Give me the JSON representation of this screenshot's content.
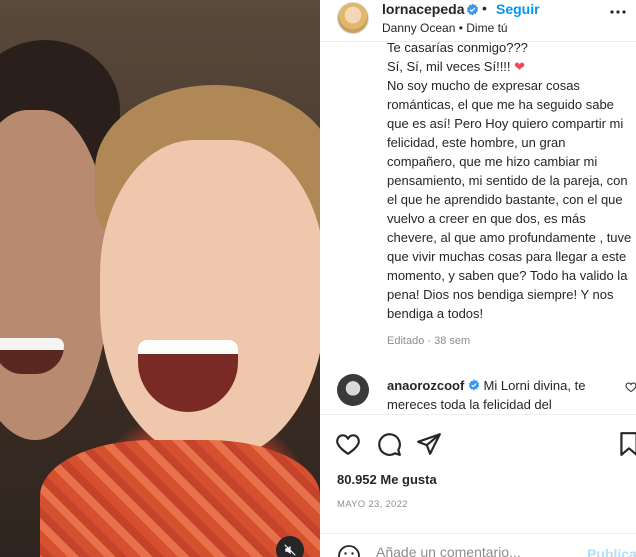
{
  "post": {
    "username": "lornacepeda",
    "follow_label": "Seguir",
    "audio": "Danny Ocean • Dime tú",
    "caption_cut_line": "Te casarías conmigo???",
    "caption_line2": "Sí, Sí, mil veces Sí!!!! ",
    "caption_heart": "❤",
    "caption_body": "No soy mucho de expresar cosas románticas, el que me ha seguido sabe que es así! Pero Hoy quiero compartir mi felicidad, este hombre, un gran compañero, que me hizo cambiar mi pensamiento, mi sentido de la pareja, con el que he aprendido bastante, con el que vuelvo a creer en que dos, es más chevere, al que amo profundamente , tuve que vivir muchas cosas para llegar a este momento, y saben que? Todo ha valido la pena! Dios nos bendiga siempre! Y nos bendiga a todos!",
    "edited": "Editado · 38 sem",
    "likes": "80.952 Me gusta",
    "date": "MAYO 23, 2022"
  },
  "comment": {
    "username": "anaorozcoof",
    "text": "Mi Lorni divina, te mereces toda la felicidad del"
  },
  "add_comment": {
    "placeholder": "Añade un comentario...",
    "publish_label": "Publicar"
  },
  "colors": {
    "accent": "#0095f6",
    "verified": "#3897f0",
    "heart": "#ed4956",
    "muted_text": "#8e8e8e"
  },
  "icons": [
    "verified-badge-icon",
    "more-options-icon",
    "heart-icon",
    "comment-icon",
    "share-icon",
    "bookmark-icon",
    "emoji-icon",
    "mute-icon"
  ]
}
